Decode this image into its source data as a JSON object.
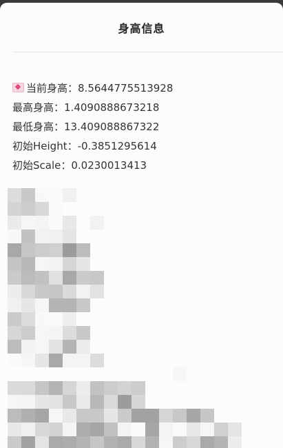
{
  "dialog": {
    "title": "身高信息"
  },
  "height_info": {
    "current_label": "当前身高：",
    "current_value": "8.5644775513928",
    "max_label": "最高身高：",
    "max_value": "1.4090888673218",
    "min_label": "最低身高：",
    "min_value": "13.409088867322",
    "initial_height_label": "初始Height：",
    "initial_height_value": "-0.3851295614",
    "initial_scale_label": "初始Scale：",
    "initial_scale_value": "0.0230013413"
  },
  "icons": {
    "current_height_icon": "heart-card-icon"
  },
  "mosaic": {
    "rows": [
      [
        "#dcdcdc",
        "#c8c8c8",
        "#f8f8f8",
        "#fafafa",
        "#f0f0f0",
        "#fcfcfc",
        "#fcfcfc",
        "#fcfcfc",
        "#fcfcfc",
        "#fcfcfc",
        "#fcfcfc",
        "#fcfcfc",
        "#fcfcfc",
        "#fcfcfc",
        "#fcfcfc",
        "#fcfcfc",
        "#fcfcfc"
      ],
      [
        "#d4d4d4",
        "#cdcdcd",
        "#d8d8d8",
        "#fafafa",
        "#fcfcfc",
        "#fcfcfc",
        "#fcfcfc",
        "#fcfcfc",
        "#fcfcfc",
        "#fcfcfc",
        "#fcfcfc",
        "#fcfcfc",
        "#fcfcfc",
        "#fcfcfc",
        "#fcfcfc",
        "#fcfcfc",
        "#fcfcfc"
      ],
      [
        "#eaeaea",
        "#f6f6f6",
        "#f4f4f4",
        "#fafafa",
        "#e8e8e8",
        "#fcfcfc",
        "#f2f2f2",
        "#fcfcfc",
        "#fcfcfc",
        "#fcfcfc",
        "#fcfcfc",
        "#fcfcfc",
        "#fcfcfc",
        "#fcfcfc",
        "#fcfcfc",
        "#fcfcfc",
        "#fcfcfc"
      ],
      [
        "#f8f8f8",
        "#c2c2c2",
        "#f2f2f2",
        "#f0f0f0",
        "#e4e4e4",
        "#fcfcfc",
        "#fcfcfc",
        "#fcfcfc",
        "#fcfcfc",
        "#fcfcfc",
        "#fcfcfc",
        "#fcfcfc",
        "#fcfcfc",
        "#fcfcfc",
        "#fcfcfc",
        "#fcfcfc",
        "#fcfcfc"
      ],
      [
        "#a8a8a8",
        "#c6c6c6",
        "#cccccc",
        "#d0d0d0",
        "#9c9c9c",
        "#bcbcbc",
        "#fcfcfc",
        "#fcfcfc",
        "#fcfcfc",
        "#fcfcfc",
        "#fcfcfc",
        "#fcfcfc",
        "#fcfcfc",
        "#fcfcfc",
        "#fcfcfc",
        "#fcfcfc",
        "#fcfcfc"
      ],
      [
        "#c4c4c4",
        "#b8b8b8",
        "#f6f6f6",
        "#f2f2f2",
        "#d6d6d6",
        "#e6e6e6",
        "#fcfcfc",
        "#fcfcfc",
        "#fcfcfc",
        "#fcfcfc",
        "#fcfcfc",
        "#fcfcfc",
        "#fcfcfc",
        "#fcfcfc",
        "#fcfcfc",
        "#fcfcfc",
        "#fcfcfc"
      ],
      [
        "#cacaca",
        "#bcbcbc",
        "#c2c2c2",
        "#e0e0e0",
        "#a8a8a8",
        "#cacaca",
        "#c8c8c8",
        "#fcfcfc",
        "#fcfcfc",
        "#fcfcfc",
        "#fcfcfc",
        "#fcfcfc",
        "#fcfcfc",
        "#fcfcfc",
        "#fcfcfc",
        "#fcfcfc",
        "#fcfcfc"
      ],
      [
        "#ececec",
        "#d8d8d8",
        "#c8c8c8",
        "#c6c6c6",
        "#dadada",
        "#f2f2f2",
        "#e2e2e2",
        "#fcfcfc",
        "#fcfcfc",
        "#fcfcfc",
        "#fcfcfc",
        "#fcfcfc",
        "#fcfcfc",
        "#fcfcfc",
        "#fcfcfc",
        "#fcfcfc",
        "#fcfcfc"
      ],
      [
        "#f0f0f0",
        "#e6e6e6",
        "#f6f6f6",
        "#b4b4b4",
        "#b4b4b4",
        "#c8c8c8",
        "#fcfcfc",
        "#fcfcfc",
        "#fcfcfc",
        "#fcfcfc",
        "#fcfcfc",
        "#fcfcfc",
        "#fcfcfc",
        "#fcfcfc",
        "#fcfcfc",
        "#fcfcfc",
        "#fcfcfc"
      ],
      [
        "#cacaca",
        "#dcdcdc",
        "#f8f8f8",
        "#fafafa",
        "#eeeeee",
        "#fcfcfc",
        "#fcfcfc",
        "#fcfcfc",
        "#fcfcfc",
        "#fcfcfc",
        "#fcfcfc",
        "#fcfcfc",
        "#fcfcfc",
        "#fcfcfc",
        "#fcfcfc",
        "#fcfcfc",
        "#fcfcfc"
      ],
      [
        "#d6d6d6",
        "#cccccc",
        "#f6f6f6",
        "#f4f4f4",
        "#dcdcdc",
        "#c8c8c8",
        "#fcfcfc",
        "#fcfcfc",
        "#fcfcfc",
        "#fcfcfc",
        "#fcfcfc",
        "#fcfcfc",
        "#fcfcfc",
        "#fcfcfc",
        "#fcfcfc",
        "#fcfcfc",
        "#fcfcfc"
      ],
      [
        "#bcbcbc",
        "#f2f2f2",
        "#f6f6f6",
        "#e2e2e2",
        "#b4b4b4",
        "#ececec",
        "#fcfcfc",
        "#fcfcfc",
        "#fcfcfc",
        "#fcfcfc",
        "#fcfcfc",
        "#fcfcfc",
        "#fcfcfc",
        "#fcfcfc",
        "#fcfcfc",
        "#fcfcfc",
        "#fcfcfc"
      ],
      [
        "#fafafa",
        "#f6f6f6",
        "#e6e6e6",
        "#a8a8a8",
        "#f4f4f4",
        "#f4f4f4",
        "#dcdcdc",
        "#fcfcfc",
        "#fcfcfc",
        "#fcfcfc",
        "#fcfcfc",
        "#fcfcfc",
        "#fcfcfc",
        "#fcfcfc",
        "#fcfcfc",
        "#fcfcfc",
        "#fcfcfc"
      ],
      [
        "#fcfcfc",
        "#fcfcfc",
        "#fcfcfc",
        "#fcfcfc",
        "#fcfcfc",
        "#fcfcfc",
        "#fcfcfc",
        "#fcfcfc",
        "#fcfcfc",
        "#fcfcfc",
        "#fcfcfc",
        "#fcfcfc",
        "#f6f6f6",
        "#fcfcfc",
        "#fcfcfc",
        "#fcfcfc",
        "#fcfcfc"
      ],
      [
        "#dadada",
        "#dadada",
        "#c6c6c6",
        "#b4b4b4",
        "#d6d6d6",
        "#ececec",
        "#c2c2c2",
        "#cccccc",
        "#d2d2d2",
        "#cccccc",
        "#fcfcfc",
        "#fcfcfc",
        "#fcfcfc",
        "#fcfcfc",
        "#fcfcfc",
        "#fcfcfc",
        "#fcfcfc"
      ],
      [
        "#f6f6f6",
        "#f4f4f4",
        "#e6e6e6",
        "#e2e2e2",
        "#c8c8c8",
        "#eaeaea",
        "#b8b8b8",
        "#dadada",
        "#9c9c9c",
        "#d6d6d6",
        "#fcfcfc",
        "#fcfcfc",
        "#fcfcfc",
        "#fcfcfc",
        "#fcfcfc",
        "#fcfcfc",
        "#fcfcfc"
      ],
      [
        "#bcbcbc",
        "#b0b0b0",
        "#a6a6a6",
        "#f6f6f6",
        "#e8e8e8",
        "#c8c8c8",
        "#c8c8c8",
        "#e6e6e6",
        "#cacaca",
        "#a2a2a2",
        "#a2a2a2",
        "#d6d6d6",
        "#c8c8c8",
        "#a6a6a6",
        "#c6c6c6",
        "#fcfcfc",
        "#fcfcfc"
      ],
      [
        "#e8e8e8",
        "#f0f0f0",
        "#d8d8d8",
        "#d4d4d4",
        "#f4f4f4",
        "#acacac",
        "#a6a6a6",
        "#c2c2c2",
        "#f4f4f4",
        "#fafafa",
        "#a6a6a6",
        "#f4f4f4",
        "#fafafa",
        "#e8e8e8",
        "#f6f6f6",
        "#d0d0d0",
        "#e4e4e4"
      ],
      [
        "#cacaca",
        "#a2a2a2",
        "#e4e4e4",
        "#aaaaaa",
        "#acacac",
        "#b4b4b4",
        "#c6c6c6",
        "#b2b2b2",
        "#aaaaaa",
        "#d8d8d8",
        "#b2b2b2",
        "#f6f6f6",
        "#cccccc",
        "#d8d8d8",
        "#aaaaaa",
        "#b4b4b4",
        "#ececec"
      ]
    ]
  }
}
